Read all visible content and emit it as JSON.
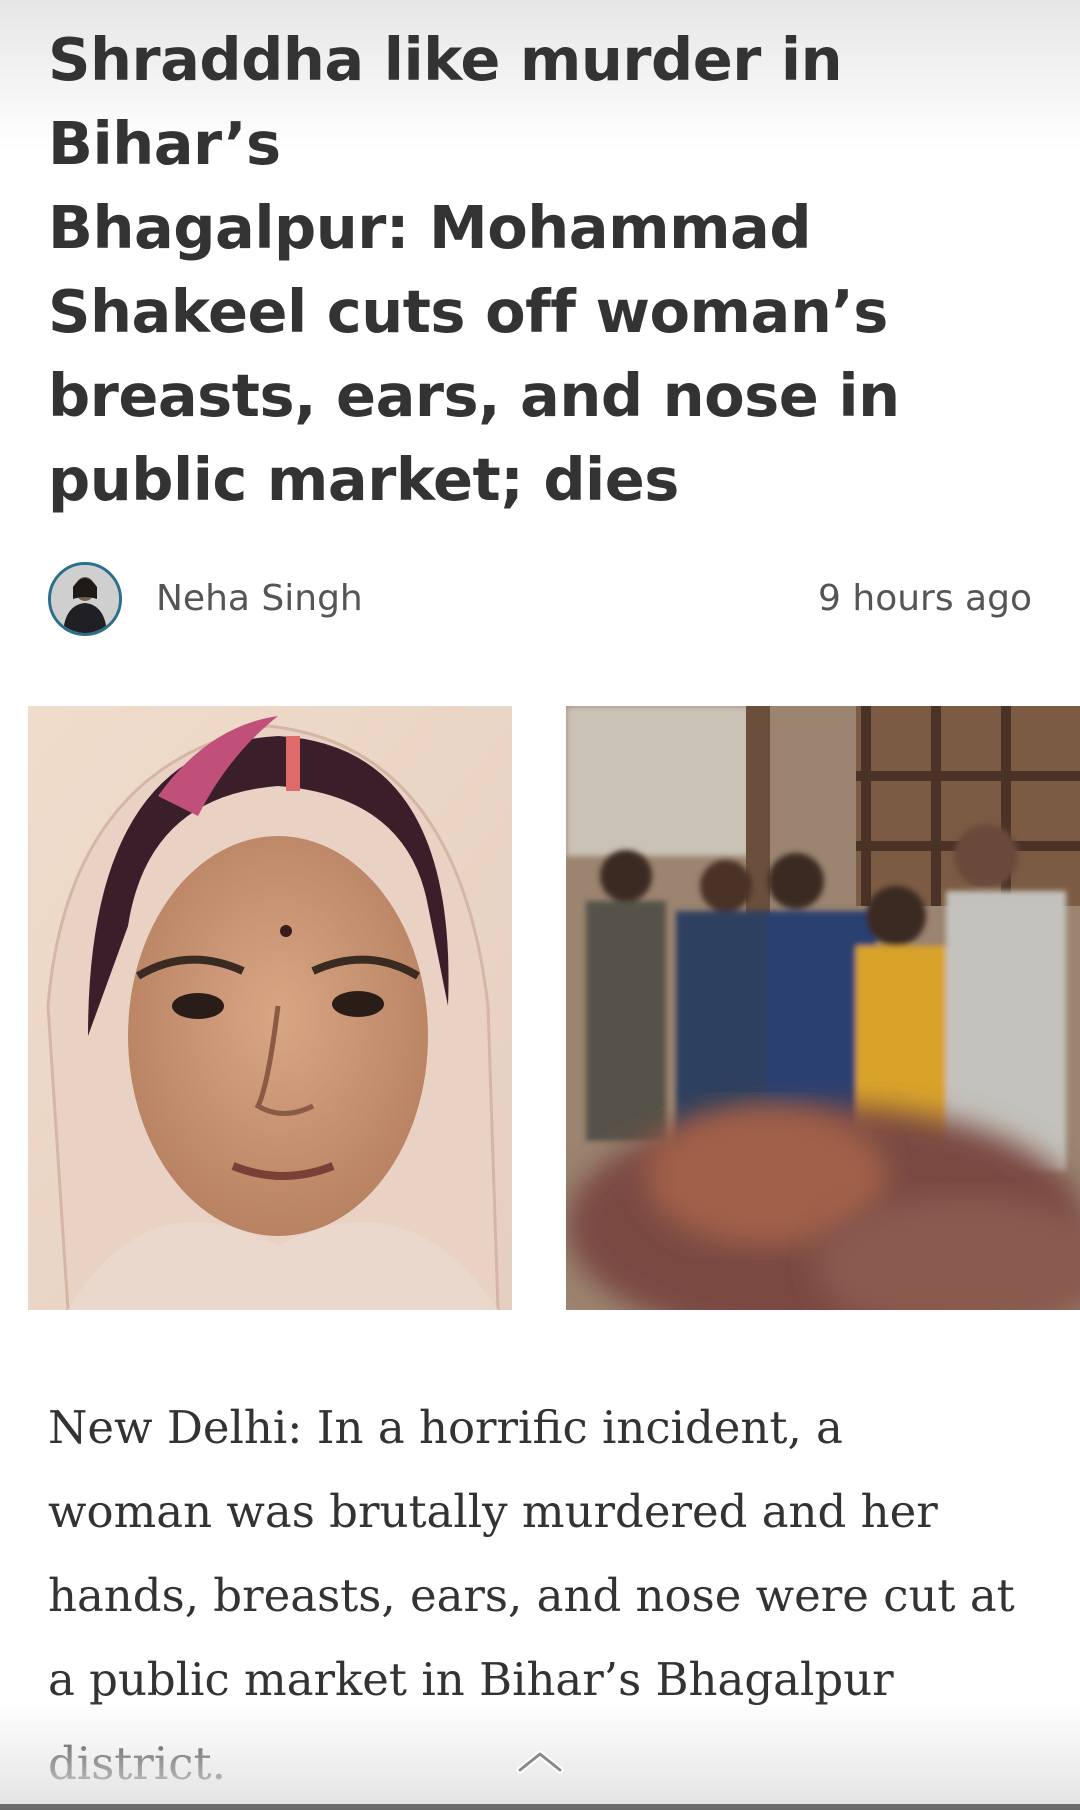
{
  "article": {
    "headline_lines": [
      "Shraddha like murder in",
      "Bihar’s",
      "Bhagalpur: Mohammad",
      "Shakeel cuts off woman’s",
      "breasts, ears, and nose in",
      "public market; dies"
    ],
    "author": "Neha Singh",
    "published": "9 hours ago",
    "body_lines": [
      "New Delhi: In a  horrific incident, a",
      "woman was brutally murdered and her",
      "hands, breasts, ears, and nose were cut at",
      "a public market in Bihar’s Bhagalpur",
      "district."
    ]
  },
  "icons": {
    "scroll_up": "chevron-up-icon",
    "avatar": "author-avatar"
  },
  "colors": {
    "headline": "#333333",
    "meta_text": "#555555",
    "avatar_ring": "#2a6f8c",
    "background": "#ffffff"
  }
}
